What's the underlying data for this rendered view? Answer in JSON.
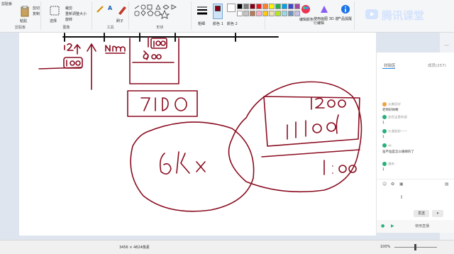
{
  "ribbon": {
    "groups": [
      "剪贴板",
      "图像",
      "工具",
      "形状",
      "颜色"
    ],
    "paste_label": "粘贴",
    "cut_label": "剪切",
    "copy_label": "复制",
    "select_label": "选择",
    "crop_label": "裁剪",
    "resize_label": "重新调整大小",
    "rotate_label": "旋转",
    "brush_label": "刷子",
    "size_label": "粗细",
    "color1_label": "颜色 1",
    "color2_label": "颜色 2",
    "edit_colors_label": "编辑颜色",
    "paint3d_label": "使用画图 3D 进行编辑",
    "product_alert_label": "产品提醒",
    "brand_text": "腾讯课堂",
    "colors": [
      "#000000",
      "#7f7f7f",
      "#880015",
      "#ed1c24",
      "#ff7f27",
      "#fff200",
      "#22b14c",
      "#00a2e8",
      "#3f48cc",
      "#a349a4",
      "#ffffff",
      "#c3c3c3",
      "#b97a57",
      "#ffaec9",
      "#ffc90e",
      "#efe4b0",
      "#b5e61d",
      "#99d9ea",
      "#7092be",
      "#c8bfe7"
    ],
    "current_color": "#880015"
  },
  "side_panel": {
    "tabs": [
      "讨论区",
      "成员(257)"
    ],
    "messages": [
      {
        "name": "大黄同学",
        "text": "老师好帅啊"
      },
      {
        "name": "正在注意听讲",
        "text": "1"
      },
      {
        "name": "沙漠驼铃一一",
        "text": "1"
      },
      {
        "name": "dc",
        "text": "准不准是怎么确保的了"
      },
      {
        "name": "满天",
        "text": "1"
      }
    ],
    "send_label": "发送",
    "footer_text": "使用直播"
  },
  "status": {
    "dimensions": "3456 × 4824像素",
    "zoom": "100%"
  },
  "canvas": {
    "handwriting": [
      "12",
      "100",
      "Nmm",
      "100",
      "500",
      "7100",
      "1200",
      "11100",
      "6kx",
      "1:00"
    ]
  }
}
